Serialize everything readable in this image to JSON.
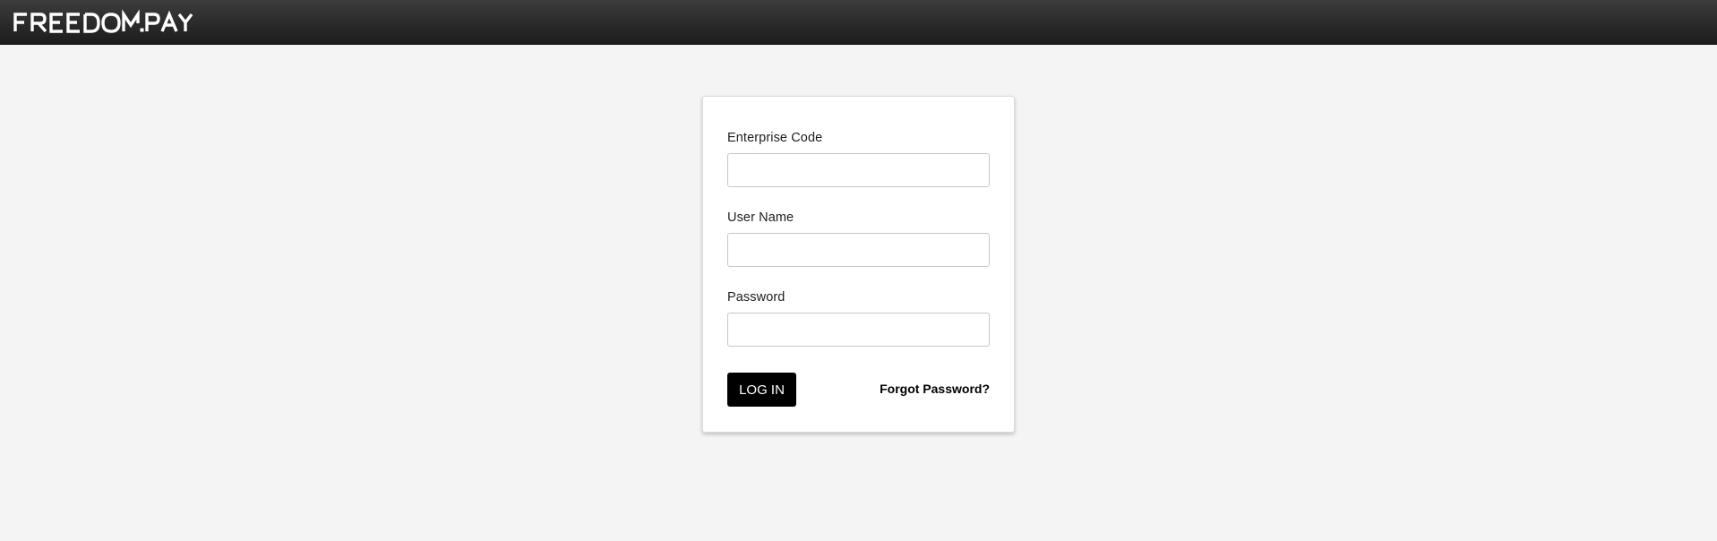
{
  "header": {
    "logo_text": "FREEDOMPAY"
  },
  "login_form": {
    "enterprise_code": {
      "label": "Enterprise Code",
      "value": "",
      "placeholder": ""
    },
    "user_name": {
      "label": "User Name",
      "value": "",
      "placeholder": ""
    },
    "password": {
      "label": "Password",
      "value": "",
      "placeholder": ""
    },
    "login_button_label": "LOG IN",
    "forgot_password_label": "Forgot Password?"
  },
  "colors": {
    "header_bg": "#2a2a2a",
    "page_bg": "#f4f4f4",
    "button_bg": "#000000",
    "button_text": "#ffffff"
  }
}
